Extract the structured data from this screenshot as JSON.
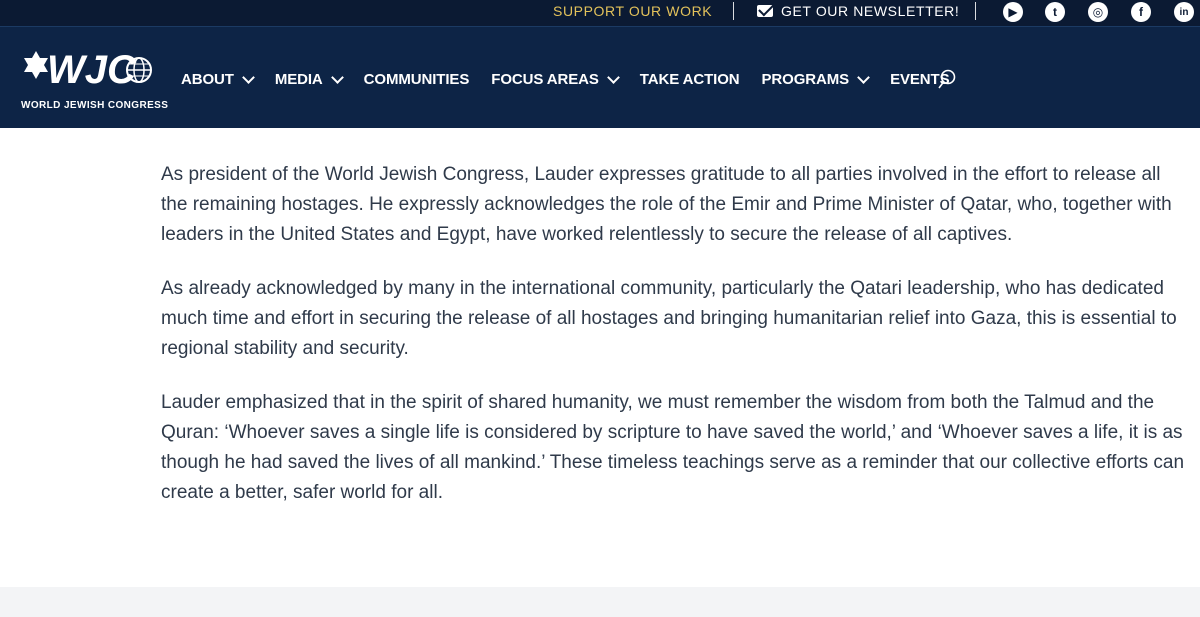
{
  "topbar": {
    "support_label": "SUPPORT OUR WORK",
    "newsletter_label": "GET OUR NEWSLETTER!",
    "social": [
      {
        "icon": "youtube-icon",
        "glyph": "▶"
      },
      {
        "icon": "twitter-icon",
        "glyph": "t"
      },
      {
        "icon": "instagram-icon",
        "glyph": "◎"
      },
      {
        "icon": "facebook-icon",
        "glyph": "f"
      },
      {
        "icon": "linkedin-icon",
        "glyph": "in"
      }
    ],
    "accent_color": "#e3c25b"
  },
  "nav": {
    "logo_text": "WORLD JEWISH CONGRESS",
    "items": [
      {
        "label": "ABOUT",
        "dropdown": true
      },
      {
        "label": "MEDIA",
        "dropdown": true
      },
      {
        "label": "COMMUNITIES",
        "dropdown": false
      },
      {
        "label": "FOCUS AREAS",
        "dropdown": true
      },
      {
        "label": "TAKE ACTION",
        "dropdown": false
      },
      {
        "label": "PROGRAMS",
        "dropdown": true
      },
      {
        "label": "EVENTS",
        "dropdown": false
      }
    ],
    "background": "#0d2446"
  },
  "article": {
    "paragraphs": [
      "As president of the World Jewish Congress, Lauder expresses gratitude to all parties involved in the effort to release all the remaining hostages. He expressly acknowledges the role of the Emir and Prime Minister of Qatar, who, together with leaders in the United States and Egypt, have worked relentlessly to secure the release of all captives.",
      "As already acknowledged by many in the international community, particularly the Qatari leadership, who has dedicated much time and effort in securing the release of all hostages and bringing humanitarian relief into Gaza, this is essential to regional stability and security.",
      "Lauder emphasized that in the spirit of shared humanity, we must remember the wisdom from both the Talmud and the Quran: ‘Whoever saves a single life is considered by scripture to have saved the world,’ and ‘Whoever saves a life, it is as though he had saved the lives of all mankind.’ These timeless teachings serve as a reminder that our collective efforts can create a better, safer world for all."
    ]
  }
}
